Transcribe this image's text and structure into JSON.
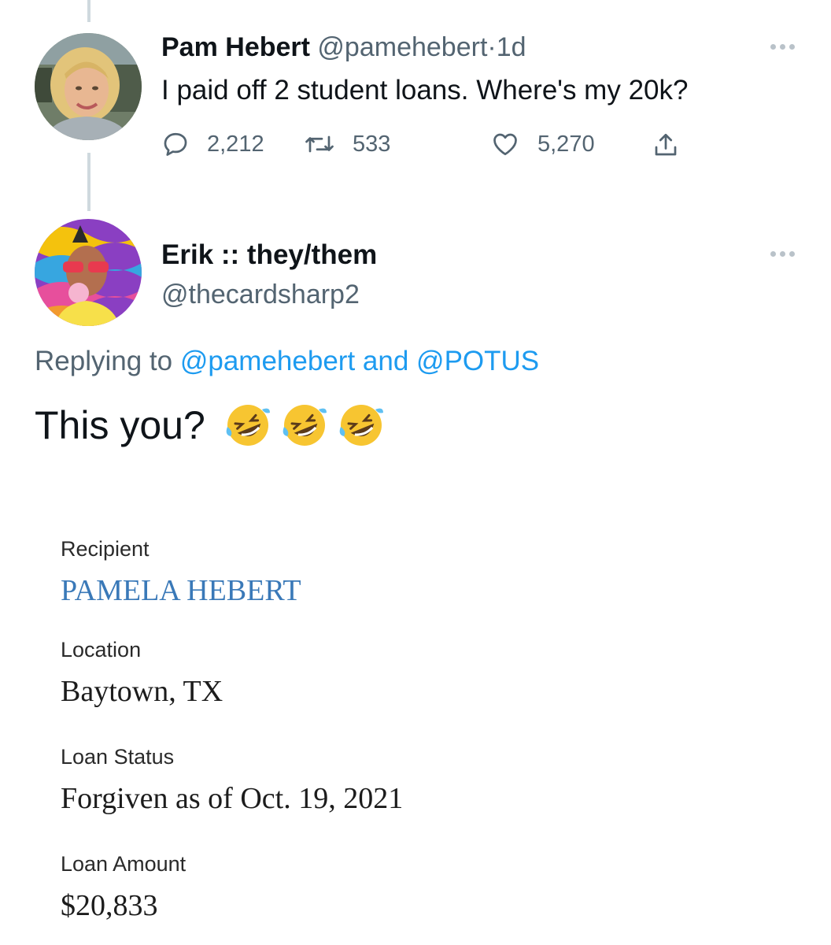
{
  "tweet1": {
    "name": "Pam Hebert",
    "handle": "@pamehebert",
    "separator": "·",
    "time": "1d",
    "text": "I paid off 2 student loans. Where's my 20k?",
    "replies": "2,212",
    "retweets": "533",
    "likes": "5,270"
  },
  "tweet2": {
    "name": "Erik :: they/them",
    "handle": "@thecardsharp2",
    "replying_prefix": "Replying to",
    "replying_to_1": "@pamehebert",
    "replying_and": "and",
    "replying_to_2": "@POTUS",
    "text": "This you?",
    "emoji": [
      "🤣",
      "🤣",
      "🤣"
    ]
  },
  "loan_record": {
    "recipient_label": "Recipient",
    "recipient_value": "PAMELA HEBERT",
    "location_label": "Location",
    "location_value": "Baytown, TX",
    "status_label": "Loan Status",
    "status_value": "Forgiven as of Oct. 19, 2021",
    "amount_label": "Loan Amount",
    "amount_value": "$20,833"
  },
  "colors": {
    "text_primary": "#0f1419",
    "text_secondary": "#536471",
    "mention": "#1d9bf0",
    "recipient_link": "#3a79b8"
  },
  "icons": {
    "reply": "reply-icon",
    "retweet": "retweet-icon",
    "like": "heart-icon",
    "share": "share-icon",
    "more": "more-icon"
  }
}
